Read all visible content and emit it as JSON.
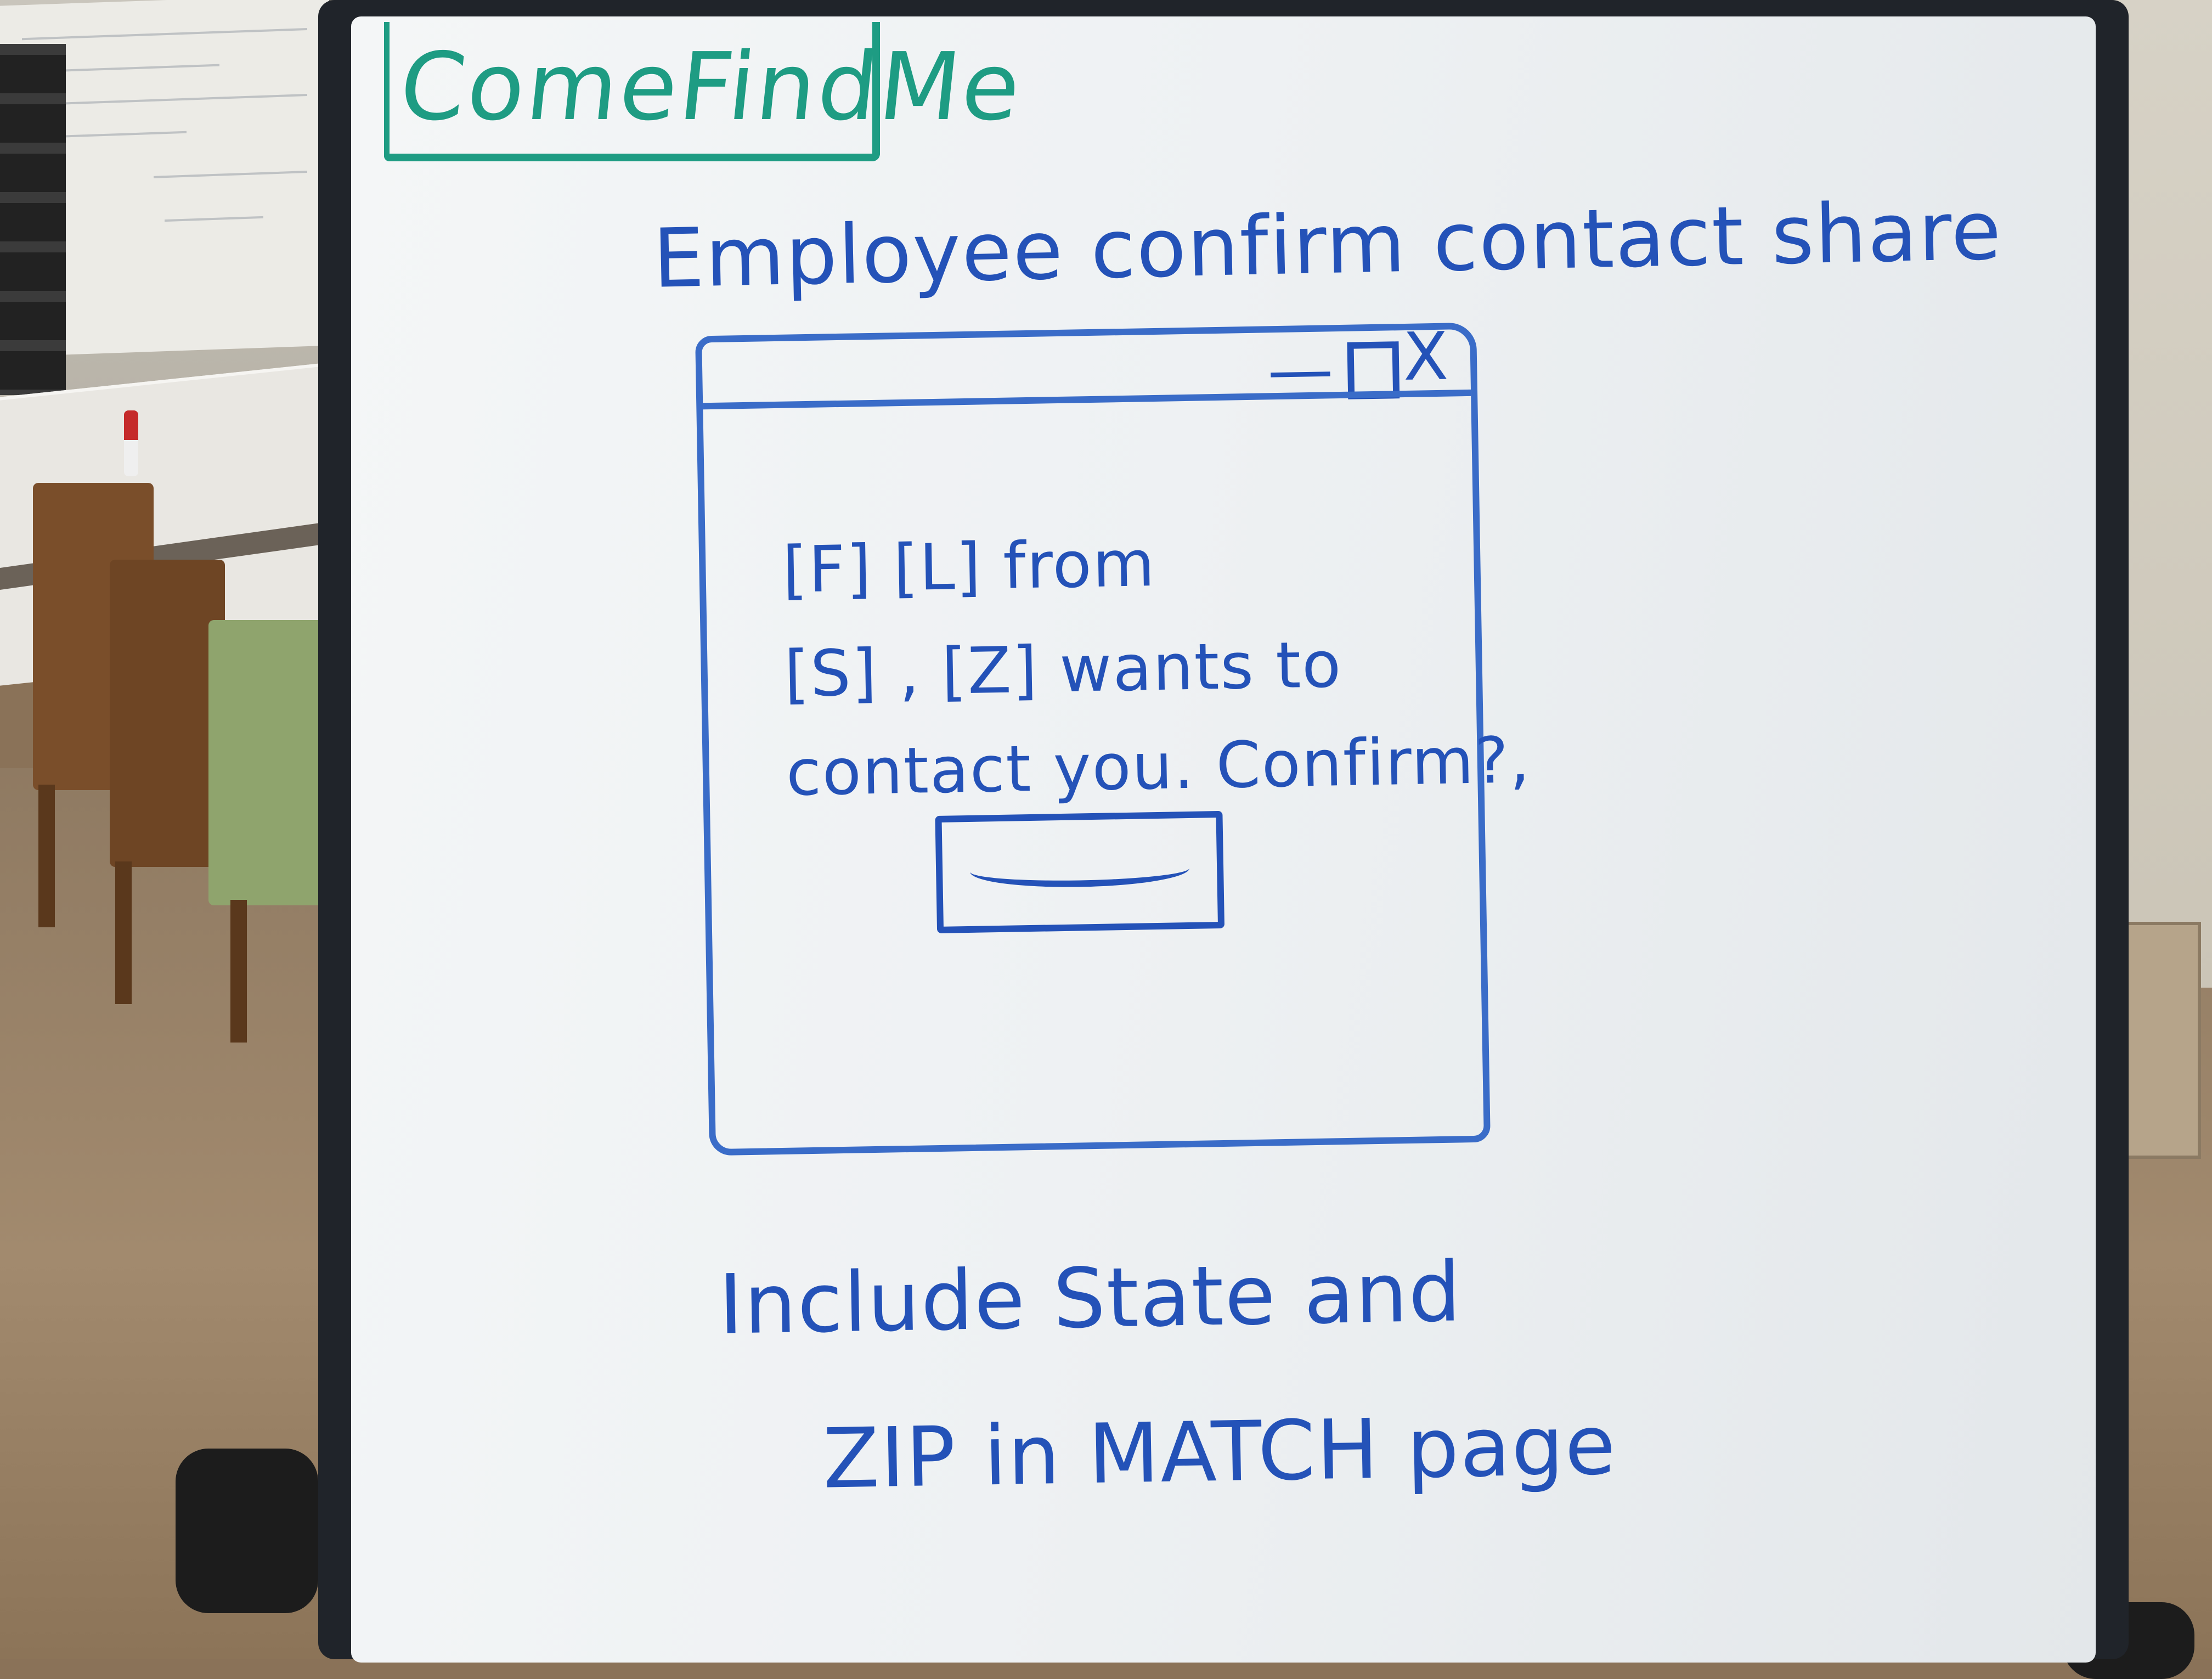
{
  "board": {
    "app_title": "ComeFindMe",
    "heading": "Employee confirm contact share",
    "sketch_window": {
      "controls": {
        "minimize": "—",
        "maximize": "",
        "close": "X"
      },
      "message_lines": [
        "[F] [L] from",
        "[S] , [Z]   wants to",
        "contact you. Confirm?,"
      ],
      "button_label": ""
    },
    "notes": [
      "Include State and",
      "ZIP in MATCH page"
    ]
  },
  "colors": {
    "marker_blue": "#2452b8",
    "marker_green": "#1e9c83",
    "whiteboard": "#f4f6f7",
    "frame": "#20242a"
  }
}
